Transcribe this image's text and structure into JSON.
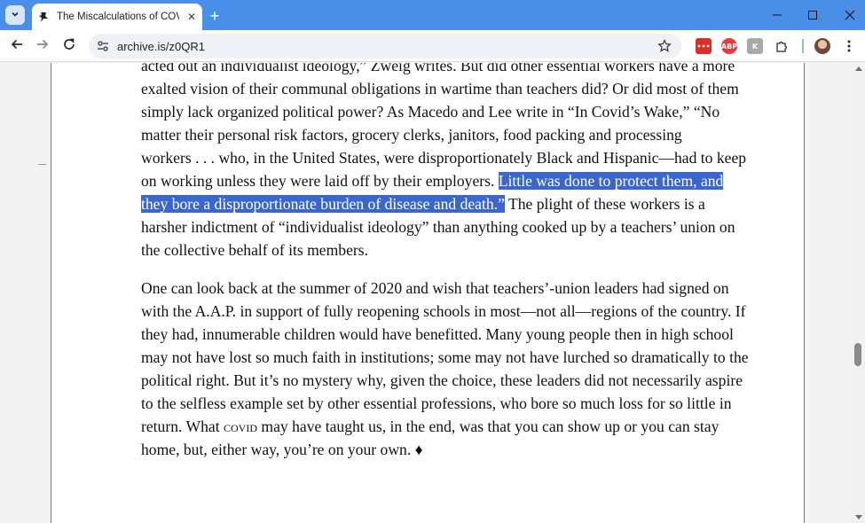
{
  "browser": {
    "tab": {
      "title": "The Miscalculations of COVID S",
      "close_glyph": "✕"
    },
    "new_tab_glyph": "+",
    "window_controls": {
      "minimize": "—",
      "maximize": "☐",
      "close": "✕"
    },
    "url": "archive.is/z0QR1",
    "extensions": [
      {
        "icon": "extension-red-icon",
        "label": "•••",
        "color": "#d93025"
      },
      {
        "icon": "adblock-plus-icon",
        "label": "ABP",
        "color": "#e8393a"
      },
      {
        "icon": "extension-gray-icon",
        "label": "K",
        "color": "#a9a9a9"
      }
    ],
    "icons": {
      "tab_search": "chevron-down-icon",
      "favicon": "archive-pin-icon",
      "back": "arrow-left-icon",
      "forward": "arrow-right-icon",
      "reload": "reload-icon",
      "site_info": "site-settings-icon",
      "bookmark": "star-icon",
      "extensions_menu": "puzzle-icon",
      "profile": "avatar",
      "menu": "three-dots-icon"
    },
    "colors": {
      "titlebar": "#4a8fe7",
      "selection": "#3b67cd"
    }
  },
  "article": {
    "paragraph1": {
      "line1": "acted out an individualist ideology,” Zweig writes. But did other essential workers have a more",
      "line2": "exalted vision of their communal obligations in wartime than teachers did? Or did most of them",
      "line3": "simply lack organized political power? As Macedo and Lee write in “In Covid’s Wake,” “No",
      "line4": "matter their personal risk factors, grocery clerks, janitors, food packing and processing",
      "line5": "workers . . . who, in the United States, were disproportionately Black and Hispanic—had to keep",
      "line6_plain": "on working unless they were laid off by their employers. ",
      "line6_selected": "Little was done to protect them, and",
      "line7_selected": "they bore a disproportionate burden of disease and death.”",
      "line7_plain": " The plight of these workers is a",
      "line8": "harsher indictment of “individualist ideology” than anything cooked up by a teachers’ union on",
      "line9": "the collective behalf of its members."
    },
    "paragraph2": {
      "line1": "One can look back at the summer of 2020 and wish that teachers’-union leaders had signed on",
      "line2": "with the A.A.P. in support of fully reopening schools in most—not all—regions of the country. If",
      "line3": "they had, innumerable children would have benefitted. Many young people then in high school",
      "line4": "may not have lost so much faith in institutions; some may not have lurched so dramatically to the",
      "line5": "political right. But it’s no mystery why, given the choice, these leaders did not necessarily aspire",
      "line6": "to the selfless example set by other essential professions, who bore so much loss for so little in",
      "line7_before": "return. What ",
      "line7_smallcaps": "covid",
      "line7_after": " may have taught us, in the end, was that you can show up or you can stay",
      "line8": "home, but, either way, you’re on your own. ♦"
    }
  }
}
